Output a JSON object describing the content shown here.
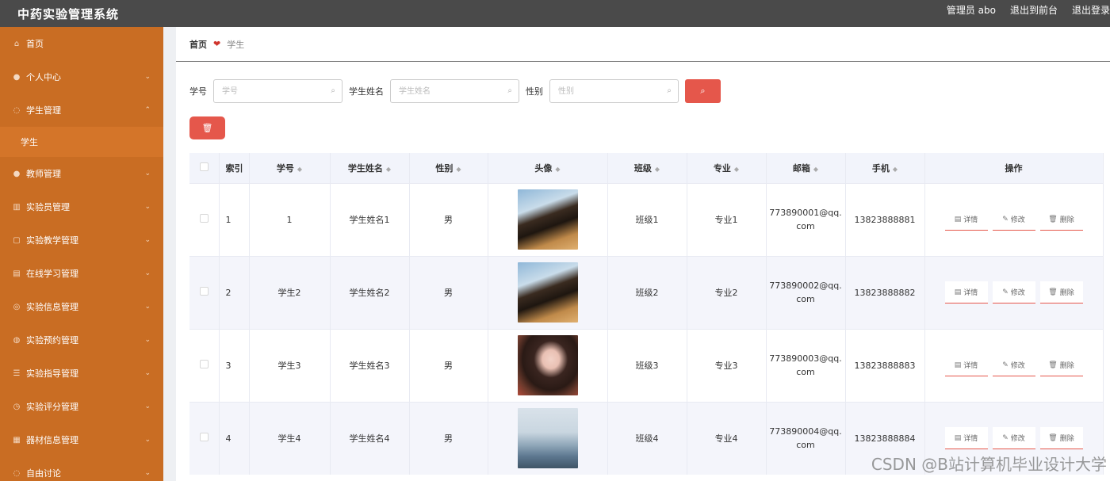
{
  "header": {
    "title": "中药实验管理系统",
    "admin_label": "管理员 abo",
    "front_label": "退出到前台",
    "logout_label": "退出登录"
  },
  "sidebar": {
    "items": [
      {
        "label": "首页",
        "icon": "home-icon",
        "glyph": "⌂",
        "chevron": ""
      },
      {
        "label": "个人中心",
        "icon": "user-icon",
        "glyph": "●",
        "chevron": "⌄"
      },
      {
        "label": "学生管理",
        "icon": "student-icon",
        "glyph": "◌",
        "chevron": "⌃"
      },
      {
        "label": "学生",
        "icon": "",
        "glyph": "",
        "chevron": "",
        "sub": true
      },
      {
        "label": "教师管理",
        "icon": "teacher-icon",
        "glyph": "●",
        "chevron": "⌄"
      },
      {
        "label": "实验员管理",
        "icon": "bar-chart-icon",
        "glyph": "▥",
        "chevron": "⌄"
      },
      {
        "label": "实验教学管理",
        "icon": "copy-icon",
        "glyph": "▢",
        "chevron": "⌄"
      },
      {
        "label": "在线学习管理",
        "icon": "book-icon",
        "glyph": "▤",
        "chevron": "⌄"
      },
      {
        "label": "实验信息管理",
        "icon": "info-icon",
        "glyph": "◎",
        "chevron": "⌄"
      },
      {
        "label": "实验预约管理",
        "icon": "mic-icon",
        "glyph": "◍",
        "chevron": "⌄"
      },
      {
        "label": "实验指导管理",
        "icon": "list-icon",
        "glyph": "☰",
        "chevron": "⌄"
      },
      {
        "label": "实验评分管理",
        "icon": "clock-icon",
        "glyph": "◷",
        "chevron": "⌄"
      },
      {
        "label": "器材信息管理",
        "icon": "equipment-icon",
        "glyph": "▦",
        "chevron": "⌄"
      },
      {
        "label": "自由讨论",
        "icon": "chat-icon",
        "glyph": "◌",
        "chevron": "⌄"
      }
    ]
  },
  "breadcrumb": {
    "home": "首页",
    "current": "学生"
  },
  "search": {
    "student_no_label": "学号",
    "student_no_placeholder": "学号",
    "name_label": "学生姓名",
    "name_placeholder": "学生姓名",
    "gender_label": "性别",
    "gender_placeholder": "性别"
  },
  "table": {
    "headers": [
      "索引",
      "学号",
      "学生姓名",
      "性别",
      "头像",
      "班级",
      "专业",
      "邮箱",
      "手机",
      "操作"
    ],
    "rows": [
      {
        "index": "1",
        "student_no": "1",
        "name": "学生姓名1",
        "gender": "男",
        "class": "班级1",
        "major": "专业1",
        "email_a": "773890001@qq.",
        "email_b": "com",
        "phone": "13823888881"
      },
      {
        "index": "2",
        "student_no": "学生2",
        "name": "学生姓名2",
        "gender": "男",
        "class": "班级2",
        "major": "专业2",
        "email_a": "773890002@qq.",
        "email_b": "com",
        "phone": "13823888882"
      },
      {
        "index": "3",
        "student_no": "学生3",
        "name": "学生姓名3",
        "gender": "男",
        "class": "班级3",
        "major": "专业3",
        "email_a": "773890003@qq.",
        "email_b": "com",
        "phone": "13823888883"
      },
      {
        "index": "4",
        "student_no": "学生4",
        "name": "学生姓名4",
        "gender": "男",
        "class": "班级4",
        "major": "专业4",
        "email_a": "773890004@qq.",
        "email_b": "com",
        "phone": "13823888884"
      }
    ],
    "actions": {
      "detail": "详情",
      "edit": "修改",
      "delete": "删除"
    }
  },
  "watermark": "CSDN @B站计算机毕业设计大学",
  "colors": {
    "header_bg": "#4a4a4a",
    "sidebar_bg": "#c96d23",
    "accent_red": "#e5574b"
  }
}
